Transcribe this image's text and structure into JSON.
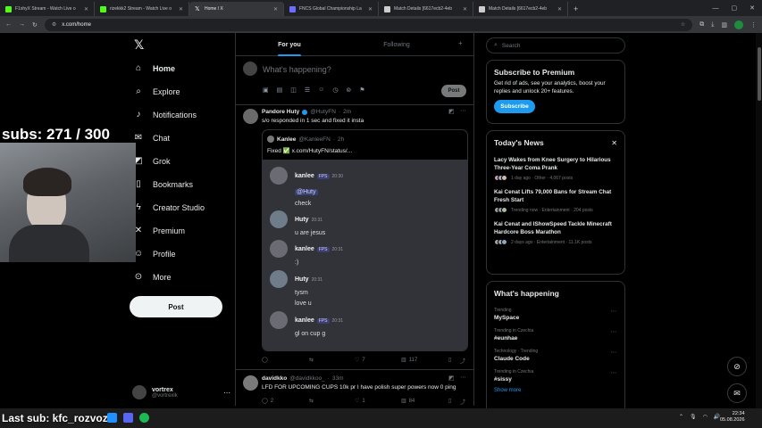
{
  "browser": {
    "tabs": [
      {
        "title": "F1shyX Stream - Watch Live o",
        "color": "#53fc18"
      },
      {
        "title": "rizekkk2 Stream - Watch Live o",
        "color": "#53fc18"
      },
      {
        "title": "Home / X",
        "color": "#ffffff",
        "active": true
      },
      {
        "title": "FNCS Global Championship La",
        "color": "#6c6cff"
      },
      {
        "title": "Match Details [6617ecb2-4eb",
        "color": "#cccccc"
      },
      {
        "title": "Match Details [6617ecb2-4eb",
        "color": "#cccccc"
      }
    ],
    "url": "x.com/home"
  },
  "nav": {
    "items": [
      {
        "label": "Home",
        "icon": "⌂",
        "bold": true
      },
      {
        "label": "Explore",
        "icon": "⌕"
      },
      {
        "label": "Notifications",
        "icon": "🔔"
      },
      {
        "label": "Chat",
        "icon": "✉"
      },
      {
        "label": "Grok",
        "icon": "◩"
      },
      {
        "label": "Bookmarks",
        "icon": "🔖"
      },
      {
        "label": "Creator Studio",
        "icon": "⚡"
      },
      {
        "label": "Premium",
        "icon": "X"
      },
      {
        "label": "Profile",
        "icon": "👤"
      },
      {
        "label": "More",
        "icon": "⋯"
      }
    ],
    "post_label": "Post",
    "account": {
      "name": "vortrex",
      "handle": "@vortrexlk"
    }
  },
  "overlay": {
    "subs_text": "subs: 271 / 300",
    "last_sub_text": "Last sub: kfc_rozvoz"
  },
  "timeline": {
    "tabs": [
      "For you",
      "Following"
    ],
    "composer_placeholder": "What's happening?",
    "composer_post": "Post",
    "tweet1": {
      "name": "Pandore Huty",
      "handle": "@HutyFN",
      "time": "2m",
      "text": "s/o responded in 1 sec and fixed it insta",
      "quote": {
        "name": "Kanlee",
        "handle": "@KanleeFN",
        "time": "2h",
        "text": "Fixed ✅ x.com/HutyFN/status/..."
      },
      "discord": [
        {
          "name": "kanlee",
          "badge": "FPS",
          "time": "20:30",
          "lines": [
            "@Huty",
            "check"
          ]
        },
        {
          "name": "Huty",
          "time": "20:31",
          "lines": [
            "u are jesus"
          ]
        },
        {
          "name": "kanlee",
          "badge": "FPS",
          "time": "20:31",
          "lines": [
            ":)"
          ]
        },
        {
          "name": "Huty",
          "time": "20:31",
          "lines": [
            "tysm",
            "love u"
          ]
        },
        {
          "name": "kanlee",
          "badge": "FPS",
          "time": "20:31",
          "lines": [
            "gl on cup g"
          ]
        }
      ],
      "likes": "7",
      "views": "117"
    },
    "tweet2": {
      "name": "davidkko",
      "handle": "@davidkkoo_",
      "time": "33m",
      "text": "LFD FOR UPCOMING CUPS 10k pr I have polish super powers now 0 ping",
      "replies": "2",
      "likes": "1",
      "views": "84"
    }
  },
  "sidebar": {
    "search_placeholder": "Search",
    "premium": {
      "title": "Subscribe to Premium",
      "text": "Get rid of ads, see your analytics, boost your replies and unlock 20+ features.",
      "button": "Subscribe"
    },
    "news": {
      "title": "Today's News",
      "items": [
        {
          "title": "Lacy Wakes from Knee Surgery to Hilarious Three-Year Coma Prank",
          "meta": "1 day ago · Other · 4,067 posts"
        },
        {
          "title": "Kai Cenat Lifts 79,000 Bans for Stream Chat Fresh Start",
          "meta": "Trending now · Entertainment · 204 posts"
        },
        {
          "title": "Kai Cenat and IShowSpeed Tackle Minecraft Hardcore Boss Marathon",
          "meta": "2 days ago · Entertainment · 11.1K posts"
        }
      ]
    },
    "happening": {
      "title": "What's happening",
      "items": [
        {
          "context": "Trending",
          "name": "MySpace"
        },
        {
          "context": "Trending in Czechia",
          "name": "#eunhae"
        },
        {
          "context": "Technology · Trending",
          "name": "Claude Code"
        },
        {
          "context": "Trending in Czechia",
          "name": "#sissy"
        }
      ],
      "show_more": "Show more"
    }
  },
  "taskbar": {
    "time": "22:34",
    "date": "05.08.2026"
  }
}
